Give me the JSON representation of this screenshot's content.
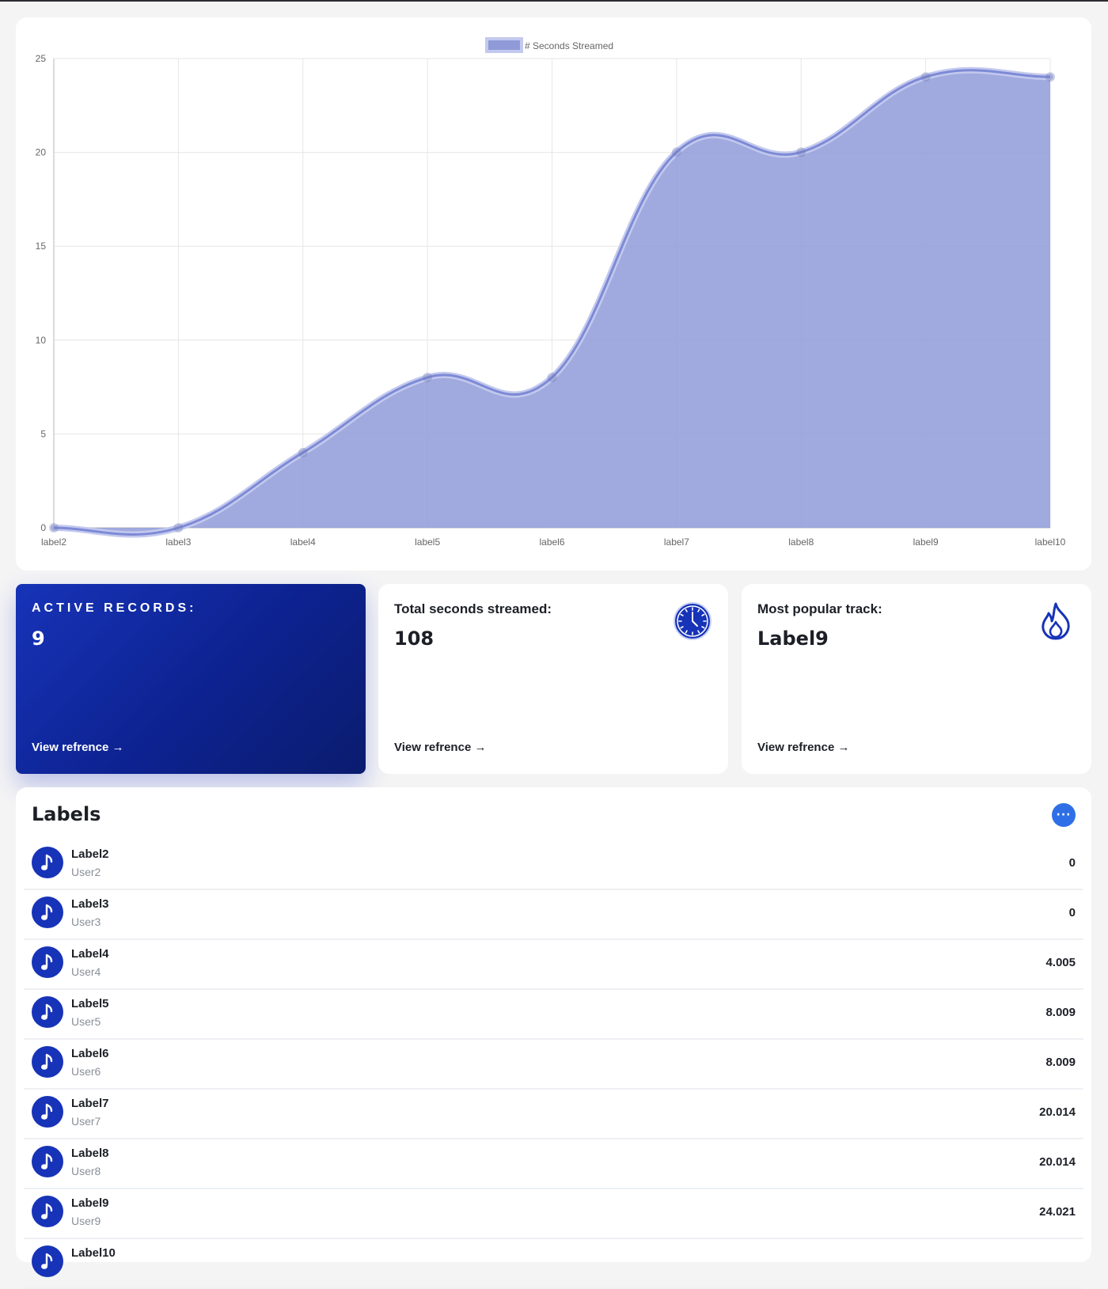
{
  "chart_data": {
    "type": "area",
    "categories": [
      "label2",
      "label3",
      "label4",
      "label5",
      "label6",
      "label7",
      "label8",
      "label9",
      "label10"
    ],
    "series": [
      {
        "name": "# Seconds Streamed",
        "values": [
          0,
          0,
          4.005,
          8.009,
          8.009,
          20.014,
          20.014,
          24.021,
          24.021
        ]
      }
    ],
    "ylim": [
      0,
      25
    ],
    "y_ticks": [
      "0",
      "5",
      "10",
      "15",
      "20",
      "25"
    ],
    "grid": true,
    "legend_position": "top",
    "fill_color": "#8f9bd8",
    "line_color": "#7d8ad6"
  },
  "stats": {
    "active": {
      "title": "ACTIVE RECORDS:",
      "value": "9",
      "link": "View refrence"
    },
    "seconds": {
      "title": "Total seconds streamed:",
      "value": "108",
      "link": "View refrence",
      "icon": "clock-icon"
    },
    "popular": {
      "title": "Most popular track:",
      "value": "Label9",
      "link": "View refrence",
      "icon": "flame-icon"
    }
  },
  "labels_panel": {
    "title": "Labels",
    "more_label": "···",
    "rows": [
      {
        "title": "Label2",
        "user": "User2",
        "value": "0"
      },
      {
        "title": "Label3",
        "user": "User3",
        "value": "0"
      },
      {
        "title": "Label4",
        "user": "User4",
        "value": "4.005"
      },
      {
        "title": "Label5",
        "user": "User5",
        "value": "8.009"
      },
      {
        "title": "Label6",
        "user": "User6",
        "value": "8.009"
      },
      {
        "title": "Label7",
        "user": "User7",
        "value": "20.014"
      },
      {
        "title": "Label8",
        "user": "User8",
        "value": "20.014"
      },
      {
        "title": "Label9",
        "user": "User9",
        "value": "24.021"
      },
      {
        "title": "Label10",
        "user": "",
        "value": ""
      }
    ]
  },
  "colors": {
    "accent": "#1733b8",
    "button": "#2f6fe6"
  }
}
